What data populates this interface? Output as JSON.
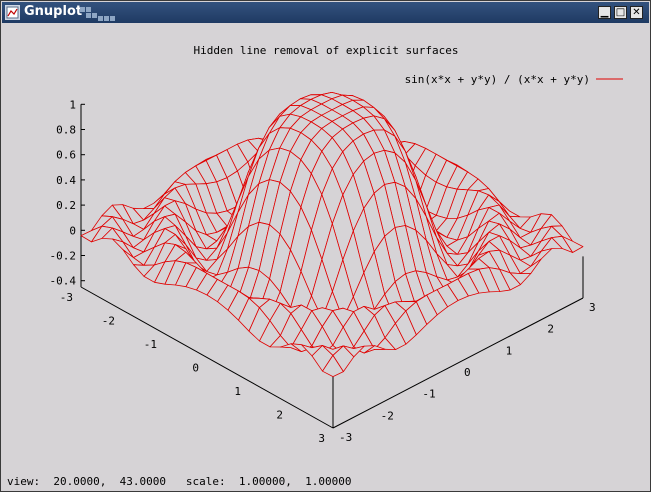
{
  "window": {
    "title": "Gnuplot",
    "controls": {
      "minimize": "▁",
      "maximize": "□",
      "close": "✕"
    },
    "icon": "gnuplot-app-icon"
  },
  "status_bar": {
    "view_label": "view:",
    "view_rot_x": "20.0000,",
    "view_rot_z": "43.0000",
    "scale_label": "scale:",
    "scale_xy": "1.00000,",
    "scale_z": "1.00000"
  },
  "chart_data": {
    "type": "surface-mesh",
    "title": "Hidden line removal of explicit surfaces",
    "function": "sin(x*x + y*y) / (x*x + y*y)",
    "series": [
      {
        "name": "sin(x*x + y*y) / (x*x + y*y)",
        "color": "#e00000"
      }
    ],
    "x_range": [
      -3,
      3
    ],
    "y_range": [
      -3,
      3
    ],
    "z_ticks": [
      "1",
      "0.8",
      "0.6",
      "0.4",
      "0.2",
      "0",
      "-0.2",
      "-0.4"
    ],
    "x_ticks": [
      "-3",
      "-2",
      "-1",
      "0",
      "1",
      "2",
      "3"
    ],
    "y_ticks": [
      "-3",
      "-2",
      "-1",
      "0",
      "1",
      "2",
      "3"
    ],
    "isosamples": 25,
    "view": {
      "rot_x": 20,
      "rot_z": 43,
      "scale": 1,
      "scale_z": 1
    },
    "hidden3d": true,
    "legend_position": "top-right"
  }
}
